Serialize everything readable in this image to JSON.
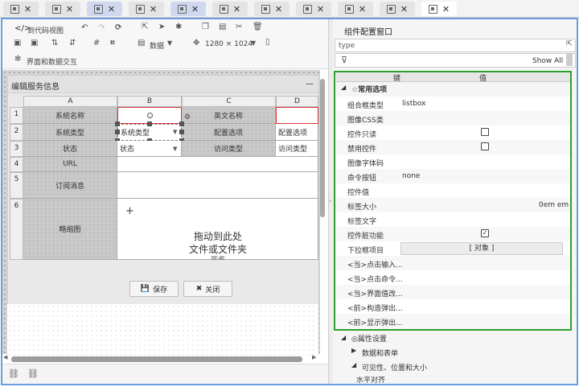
{
  "tabs": [
    {
      "state": "normal"
    },
    {
      "state": "normal"
    },
    {
      "state": "selected"
    },
    {
      "state": "normal"
    },
    {
      "state": "selected"
    },
    {
      "state": "normal"
    },
    {
      "state": "normal"
    },
    {
      "state": "normal"
    },
    {
      "state": "normal"
    },
    {
      "state": "normal"
    },
    {
      "state": "active"
    }
  ],
  "toolbar": {
    "to_code_view": "到代码视图",
    "data_dropdown": "数据",
    "resolution": "1280 × 1024",
    "interaction": "界面和数据交互"
  },
  "form": {
    "title": "编辑服务信息",
    "minimize": "—",
    "columns": [
      "A",
      "B",
      "C",
      "D"
    ],
    "rows": [
      "1",
      "2",
      "3",
      "4",
      "5",
      "6"
    ],
    "labels": {
      "system_name": "系统名称",
      "english_name": "英文名称",
      "system_type": "系统类型",
      "config_option": "配置选项",
      "status": "状态",
      "access_type": "访问类型",
      "url": "URL",
      "subscription": "订阅消息",
      "thumbnail": "略缩图"
    },
    "inputs": {
      "system_type_value": "系统类型",
      "status_value": "状态",
      "config_option_value": "配置选项",
      "access_type_value": "访问类型"
    },
    "drop_text_line1": "拖动到此处",
    "drop_text_line2": "文件或文件夹",
    "drop_text_line3": "或者",
    "plus": "+",
    "save": "保存",
    "close": "关闭"
  },
  "right": {
    "title": "组件配置窗口",
    "type_placeholder": "type",
    "show_all": "Show All",
    "col_key": "键",
    "col_value": "值",
    "section_common": "☆常用选项",
    "props": [
      {
        "key": "组合框类型",
        "value": "listbox"
      },
      {
        "key": "图像CSS类",
        "value": ""
      },
      {
        "key": "控件只读",
        "value": "",
        "checkbox": "unchecked"
      },
      {
        "key": "禁用控件",
        "value": "",
        "checkbox": "unchecked"
      },
      {
        "key": "图像字体码",
        "value": ""
      },
      {
        "key": "命令按钮",
        "value": "none"
      },
      {
        "key": "控件值",
        "value": ""
      },
      {
        "key": "标签大小",
        "value": "0em em"
      },
      {
        "key": "标签文字",
        "value": ""
      },
      {
        "key": "控件脏功能",
        "value": "",
        "checkbox": "checked"
      },
      {
        "key": "下拉框项目",
        "value": "[ 对象 ]"
      },
      {
        "key": "<当>点击输入...",
        "value": ""
      },
      {
        "key": "<当>点击命令...",
        "value": ""
      },
      {
        "key": "<当>界面值改...",
        "value": ""
      },
      {
        "key": "<前>构造弹出...",
        "value": ""
      },
      {
        "key": "<前>显示弹出...",
        "value": ""
      }
    ],
    "section_attr": "◎属性设置",
    "sub_items": [
      "数据和表单",
      "可见性、位置和大小",
      "水平对齐"
    ]
  }
}
